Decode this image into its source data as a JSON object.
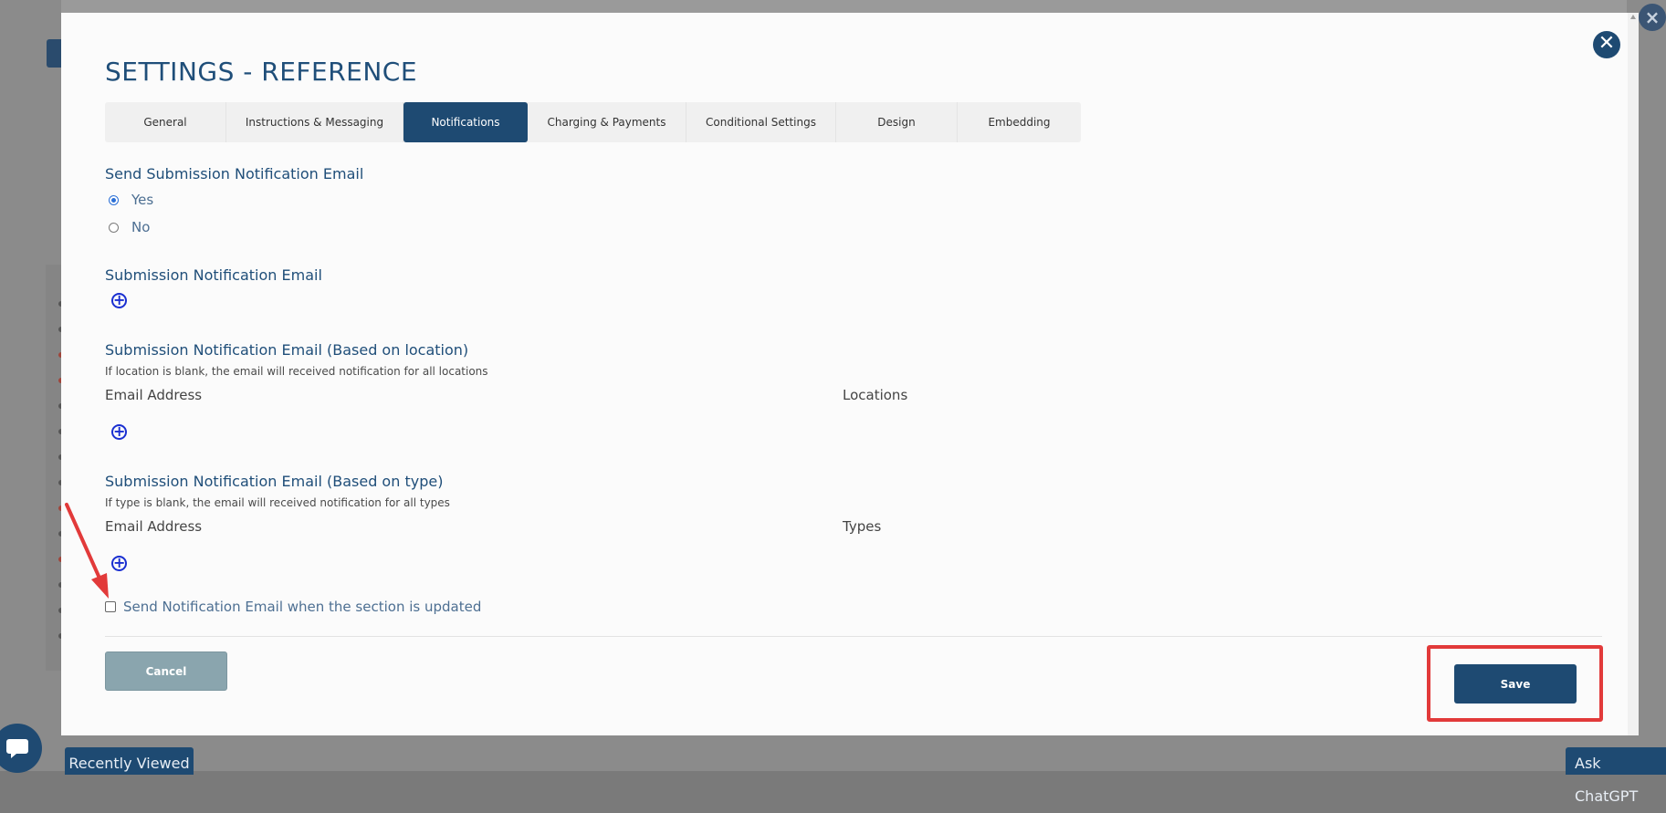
{
  "background": {
    "close_icon": "×",
    "recently_viewed_label": "Recently Viewed",
    "ask_chatgpt_label": "Ask ChatGPT"
  },
  "modal": {
    "title": "SETTINGS - REFERENCE",
    "close_icon": "✕",
    "tabs": [
      {
        "label": "General",
        "active": false
      },
      {
        "label": "Instructions & Messaging",
        "active": false
      },
      {
        "label": "Notifications",
        "active": true
      },
      {
        "label": "Charging & Payments",
        "active": false
      },
      {
        "label": "Conditional Settings",
        "active": false
      },
      {
        "label": "Design",
        "active": false
      },
      {
        "label": "Embedding",
        "active": false
      }
    ],
    "send_submission": {
      "title": "Send Submission Notification Email",
      "options": [
        {
          "label": "Yes",
          "checked": true
        },
        {
          "label": "No",
          "checked": false
        }
      ]
    },
    "submission_email": {
      "title": "Submission Notification Email"
    },
    "by_location": {
      "title": "Submission Notification Email (Based on location)",
      "hint": "If location is blank, the email will received notification for all locations",
      "col_email": "Email Address",
      "col_other": "Locations"
    },
    "by_type": {
      "title": "Submission Notification Email (Based on type)",
      "hint": "If type is blank, the email will received notification for all types",
      "col_email": "Email Address",
      "col_other": "Types"
    },
    "section_update_checkbox": {
      "label": "Send Notification Email when the section is updated",
      "checked": false
    },
    "cancel_label": "Cancel",
    "save_label": "Save"
  },
  "colors": {
    "primary": "#1e4a72",
    "heading": "#1f4e79",
    "annotation": "#e23a3a",
    "add_icon": "#1a2fd1"
  }
}
